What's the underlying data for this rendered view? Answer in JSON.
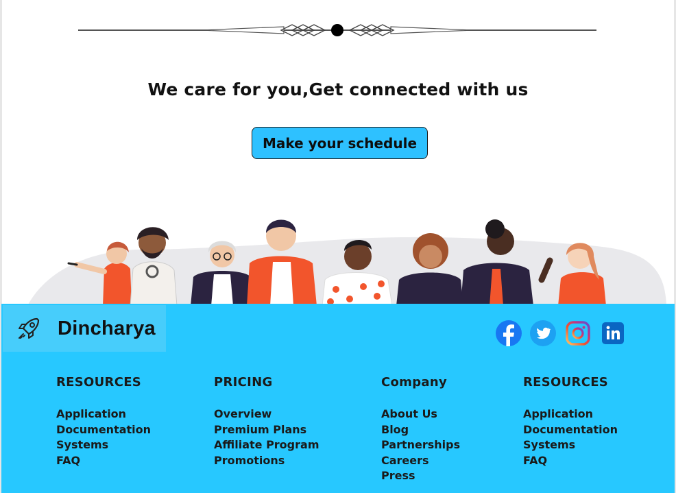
{
  "hero": {
    "headline": "We care  for you,Get connected with us",
    "cta_label": "Make your schedule"
  },
  "footer": {
    "brand": {
      "name": "Dincharya",
      "logo_icon": "rocket-icon"
    },
    "social": [
      {
        "name": "facebook-icon",
        "color": "#1877f2"
      },
      {
        "name": "twitter-icon",
        "color": "#1da1f2"
      },
      {
        "name": "instagram-icon",
        "color": "#e1306c"
      },
      {
        "name": "linkedin-icon",
        "color": "#0a66c2"
      }
    ],
    "columns": [
      {
        "heading": "RESOURCES",
        "links": [
          "Application",
          "Documentation",
          "Systems",
          "FAQ"
        ]
      },
      {
        "heading": "PRICING",
        "links": [
          "Overview",
          "Premium Plans",
          "Affiliate Program",
          "Promotions"
        ]
      },
      {
        "heading": "Company",
        "links": [
          "About Us",
          "Blog",
          "Partnerships",
          "Careers",
          "Press"
        ]
      },
      {
        "heading": "RESOURCES",
        "links": [
          "Application",
          "Documentation",
          "Systems",
          "FAQ"
        ]
      }
    ]
  },
  "colors": {
    "accent": "#27c8ff",
    "button": "#2ec1ff",
    "brand_bg": "#47cdfb",
    "orange": "#f2552c"
  }
}
